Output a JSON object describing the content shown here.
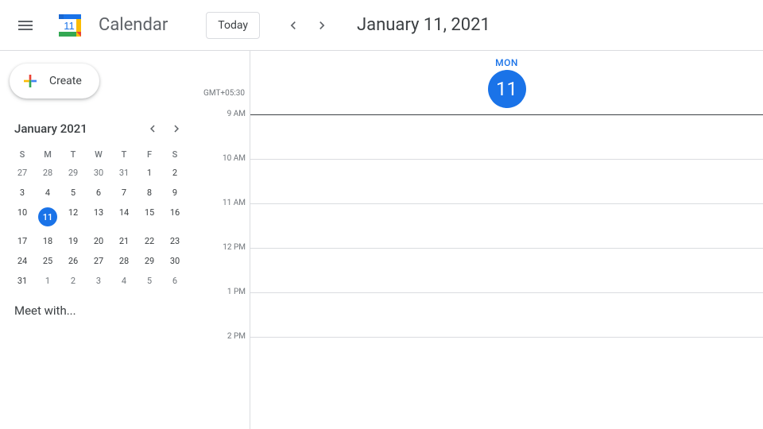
{
  "header": {
    "app_title": "Calendar",
    "logo_day": "11",
    "today_label": "Today",
    "date_display": "January 11, 2021"
  },
  "sidebar": {
    "create_label": "Create",
    "mini_cal": {
      "title": "January 2021",
      "dow": [
        "S",
        "M",
        "T",
        "W",
        "T",
        "F",
        "S"
      ],
      "weeks": [
        [
          {
            "d": "27",
            "o": true
          },
          {
            "d": "28",
            "o": true
          },
          {
            "d": "29",
            "o": true
          },
          {
            "d": "30",
            "o": true
          },
          {
            "d": "31",
            "o": true
          },
          {
            "d": "1"
          },
          {
            "d": "2"
          }
        ],
        [
          {
            "d": "3"
          },
          {
            "d": "4"
          },
          {
            "d": "5"
          },
          {
            "d": "6"
          },
          {
            "d": "7"
          },
          {
            "d": "8"
          },
          {
            "d": "9"
          }
        ],
        [
          {
            "d": "10"
          },
          {
            "d": "11",
            "sel": true
          },
          {
            "d": "12"
          },
          {
            "d": "13"
          },
          {
            "d": "14"
          },
          {
            "d": "15"
          },
          {
            "d": "16"
          }
        ],
        [
          {
            "d": "17"
          },
          {
            "d": "18"
          },
          {
            "d": "19"
          },
          {
            "d": "20"
          },
          {
            "d": "21"
          },
          {
            "d": "22"
          },
          {
            "d": "23"
          }
        ],
        [
          {
            "d": "24"
          },
          {
            "d": "25"
          },
          {
            "d": "26"
          },
          {
            "d": "27"
          },
          {
            "d": "28"
          },
          {
            "d": "29"
          },
          {
            "d": "30"
          }
        ],
        [
          {
            "d": "31"
          },
          {
            "d": "1",
            "o": true
          },
          {
            "d": "2",
            "o": true
          },
          {
            "d": "3",
            "o": true
          },
          {
            "d": "4",
            "o": true
          },
          {
            "d": "5",
            "o": true
          },
          {
            "d": "6",
            "o": true
          }
        ]
      ]
    },
    "meet_with_label": "Meet with..."
  },
  "schedule": {
    "tz": "GMT+05:30",
    "day_name": "MON",
    "day_num": "11",
    "hours": [
      "9 AM",
      "10 AM",
      "11 AM",
      "12 PM",
      "1 PM",
      "2 PM"
    ]
  }
}
